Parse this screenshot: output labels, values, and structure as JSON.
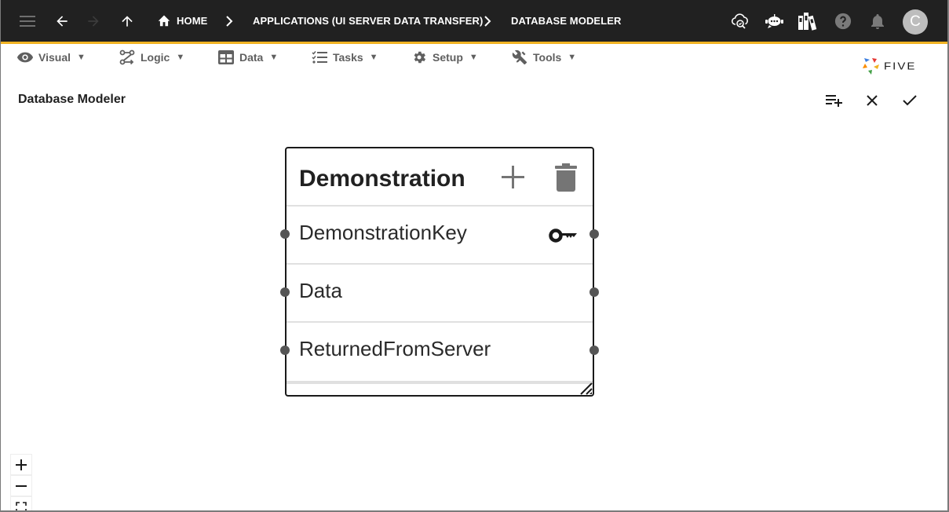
{
  "appbar": {
    "menu_icon": "hamburger-icon",
    "back_icon": "arrow-left-icon",
    "forward_icon": "arrow-right-icon",
    "up_icon": "arrow-up-icon",
    "breadcrumbs": [
      {
        "label": "HOME",
        "icon": "home-icon"
      },
      {
        "label": "APPLICATIONS (UI SERVER DATA TRANSFER)"
      },
      {
        "label": "DATABASE MODELER"
      }
    ],
    "actions": [
      "cloud-search-icon",
      "chatbot-icon",
      "library-books-icon",
      "help-icon",
      "bell-icon"
    ],
    "avatar_initial": "C",
    "colors": {
      "bar": "#212121",
      "accent": "#f0b323"
    }
  },
  "menubar": {
    "items": [
      {
        "label": "Visual",
        "icon": "eye-icon",
        "caret": "▼"
      },
      {
        "label": "Logic",
        "icon": "logic-flow-icon",
        "caret": "▼"
      },
      {
        "label": "Data",
        "icon": "table-icon",
        "caret": "▼"
      },
      {
        "label": "Tasks",
        "icon": "checklist-icon",
        "caret": "▼"
      },
      {
        "label": "Setup",
        "icon": "gear-icon",
        "caret": "▼"
      },
      {
        "label": "Tools",
        "icon": "tools-icon",
        "caret": "▼"
      }
    ]
  },
  "brand": {
    "name": "FIVE"
  },
  "page": {
    "title": "Database Modeler",
    "tools": [
      "add-entity-icon",
      "close-icon",
      "check-icon"
    ]
  },
  "entity": {
    "name": "Demonstration",
    "fields": [
      {
        "name": "DemonstrationKey",
        "primary_key": true
      },
      {
        "name": "Data",
        "primary_key": false
      },
      {
        "name": "ReturnedFromServer",
        "primary_key": false
      }
    ]
  },
  "zoom_controls": {
    "zoom_in": "+",
    "zoom_out": "−",
    "fit": "fit-screen-icon"
  }
}
